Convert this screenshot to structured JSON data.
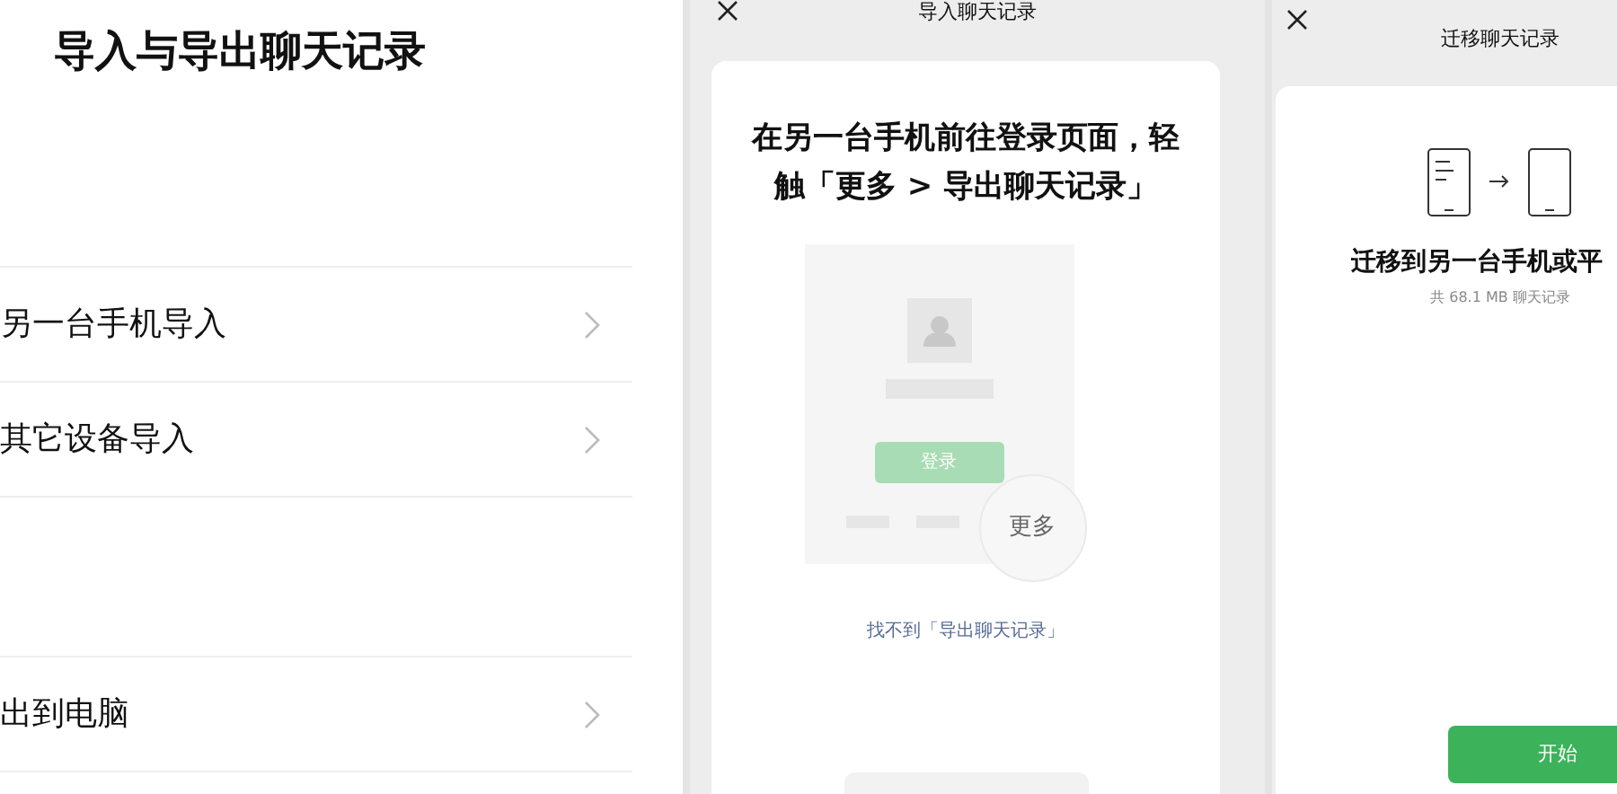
{
  "settings_screen": {
    "title": "导入与导出聊天记录",
    "groups": [
      {
        "items": [
          {
            "label": "另一台手机导入"
          },
          {
            "label": "其它设备导入"
          }
        ]
      },
      {
        "items": [
          {
            "label": "出到电脑"
          }
        ]
      }
    ]
  },
  "import_screen": {
    "title": "导入聊天记录",
    "instruction": "在另一台手机前往登录页面，轻触「更多 > 导出聊天记录」",
    "login_button": "登录",
    "more_button": "更多",
    "help_link": "找不到「导出聊天记录」"
  },
  "migrate_screen": {
    "title": "迁移聊天记录",
    "heading": "迁移到另一台手机或平",
    "size_note": "共 68.1 MB 聊天记录",
    "start_button": "开始"
  }
}
